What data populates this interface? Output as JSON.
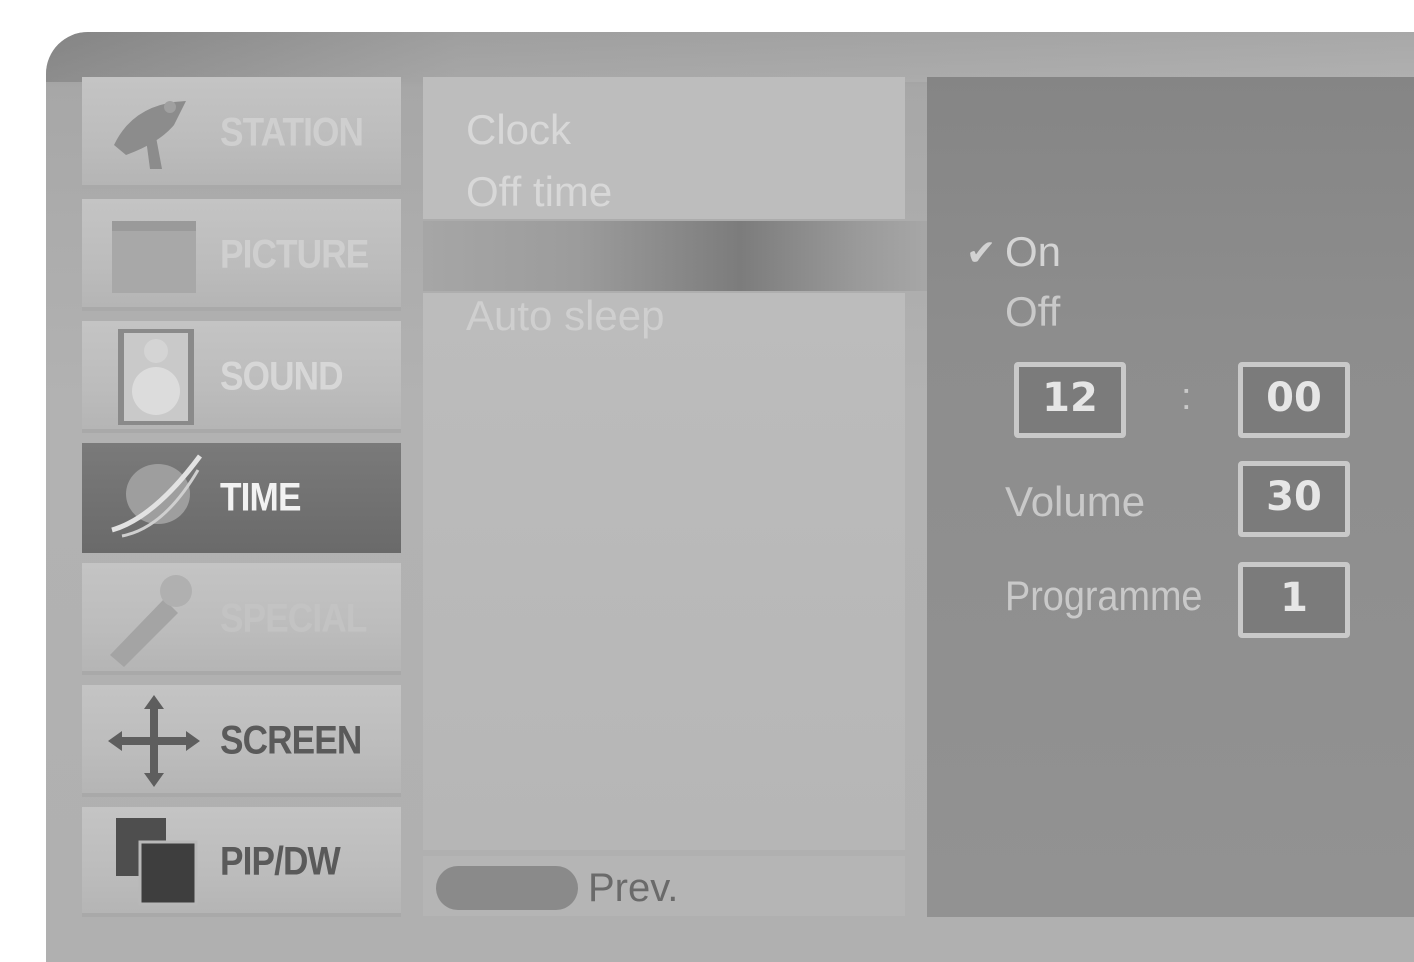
{
  "menu": {
    "items": [
      {
        "label": "STATION",
        "icon": "satellite-dish-icon"
      },
      {
        "label": "PICTURE",
        "icon": "picture-icon"
      },
      {
        "label": "SOUND",
        "icon": "speaker-icon"
      },
      {
        "label": "TIME",
        "icon": "planet-icon"
      },
      {
        "label": "SPECIAL",
        "icon": "wrench-icon"
      },
      {
        "label": "SCREEN",
        "icon": "move-arrows-icon"
      },
      {
        "label": "PIP/DW",
        "icon": "pip-windows-icon"
      }
    ],
    "active": "TIME"
  },
  "submenu": {
    "items": [
      "Clock",
      "Off time",
      "",
      "Auto sleep"
    ],
    "prev_label": "Prev."
  },
  "options": {
    "on_label": "On",
    "off_label": "Off",
    "check_mark": "✔",
    "hour": "12",
    "separator": ":",
    "minute": "00",
    "volume_label": "Volume",
    "volume_value": "30",
    "programme_label": "Programme",
    "programme_value": "1"
  }
}
